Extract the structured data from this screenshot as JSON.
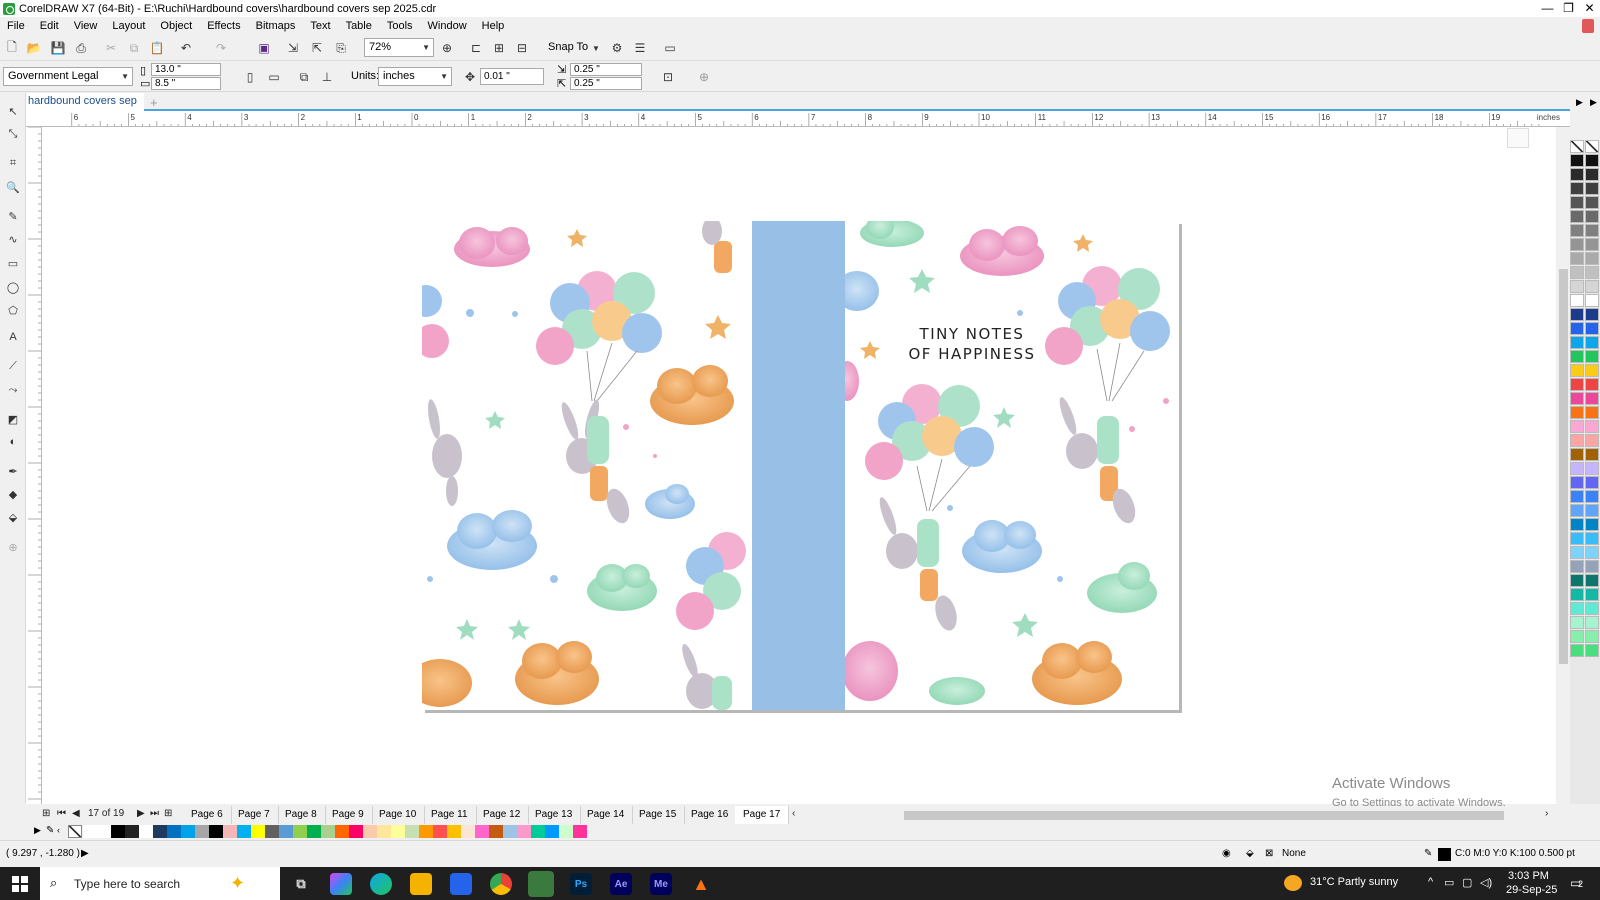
{
  "window": {
    "title": "CorelDRAW X7 (64-Bit) - E:\\Ruchi\\Hardbound covers\\hardbound covers sep 2025.cdr",
    "controls": [
      "—",
      "❐",
      "✕"
    ]
  },
  "menu": [
    "File",
    "Edit",
    "View",
    "Layout",
    "Object",
    "Effects",
    "Bitmaps",
    "Text",
    "Table",
    "Tools",
    "Window",
    "Help"
  ],
  "toolbar": {
    "zoom": "72%",
    "snap_label": "Snap To"
  },
  "property_bar": {
    "page_preset": "Government Legal",
    "page_width": "13.0 \"",
    "page_height": "8.5 \"",
    "units_label": "Units:",
    "units_value": "inches",
    "nudge": "0.01 \"",
    "dup_x": "0.25 \"",
    "dup_y": "0.25 \""
  },
  "document_tab": {
    "label": "hardbound covers sep ...",
    "add": "+"
  },
  "ruler": {
    "unit": "inches",
    "h_labels": [
      "6",
      "5",
      "4",
      "3",
      "2",
      "1",
      "0",
      "1",
      "2",
      "3",
      "4",
      "5",
      "6",
      "7",
      "8",
      "9",
      "10",
      "11",
      "12",
      "13",
      "14",
      "15",
      "16",
      "17",
      "18",
      "19"
    ]
  },
  "cover": {
    "title_line1": "TINY NOTES",
    "title_line2": "OF HAPPINESS",
    "spine_color": "#98bfe6"
  },
  "page_nav": {
    "counter": "17 of 19",
    "tabs": [
      "Page 6",
      "Page 7",
      "Page 8",
      "Page 9",
      "Page 10",
      "Page 11",
      "Page 12",
      "Page 13",
      "Page 14",
      "Page 15",
      "Page 16",
      "Page 17"
    ],
    "active": "Page 17"
  },
  "palette_colors": [
    "#111111",
    "#2b2b2b",
    "#404040",
    "#555555",
    "#6a6a6a",
    "#808080",
    "#959595",
    "#aaaaaa",
    "#c0c0c0",
    "#d5d5d5",
    "#ffffff",
    "#1e3a8a",
    "#2563eb",
    "#0ea5e9",
    "#22c55e",
    "#facc15",
    "#ef4444",
    "#ec4899",
    "#f97316",
    "#f9a8d4",
    "#fca5a5",
    "#a16207",
    "#c4b5fd",
    "#6366f1",
    "#3b82f6",
    "#60a5fa",
    "#0284c7",
    "#38bdf8",
    "#7dd3fc",
    "#94a3b8",
    "#0f766e",
    "#14b8a6",
    "#5eead4",
    "#a7f3d0",
    "#86efac",
    "#4ade80"
  ],
  "doc_palette": [
    "#ffffff",
    "#ffffff",
    "#000000",
    "#222222",
    "#ffffff",
    "#1e3a5f",
    "#0070c0",
    "#00a2e8",
    "#a6a6a6",
    "#000000",
    "#f4b6b6",
    "#00b0f0",
    "#ffff00",
    "#606060",
    "#5b9bd5",
    "#8fd14f",
    "#00b050",
    "#a9d08e",
    "#ff6600",
    "#ff0066",
    "#f8cbad",
    "#ffe699",
    "#ffff99",
    "#c6e0b4",
    "#ff9900",
    "#ff5050",
    "#ffc000",
    "#fbe5d6",
    "#ff66cc",
    "#c55a11",
    "#9dc3e6",
    "#ff99cc",
    "#00cc99",
    "#0099ff",
    "#ccffcc",
    "#ff3399"
  ],
  "status": {
    "coords": "( 9.297 , -1.280 )",
    "fill": "None",
    "outline": "C:0 M:0 Y:0 K:100  0.500 pt"
  },
  "watermark": {
    "line1": "Activate Windows",
    "line2": "Go to Settings to activate Windows."
  },
  "taskbar": {
    "search_placeholder": "Type here to search",
    "apps": [
      "Copilot",
      "Edge",
      "Explorer",
      "Store",
      "Chrome",
      "CorelDRAW",
      "Ps",
      "Ae",
      "Me",
      "VLC"
    ],
    "weather": "31°C  Partly sunny",
    "time": "3:03 PM",
    "date": "29-Sep-25",
    "notifications": "2"
  }
}
